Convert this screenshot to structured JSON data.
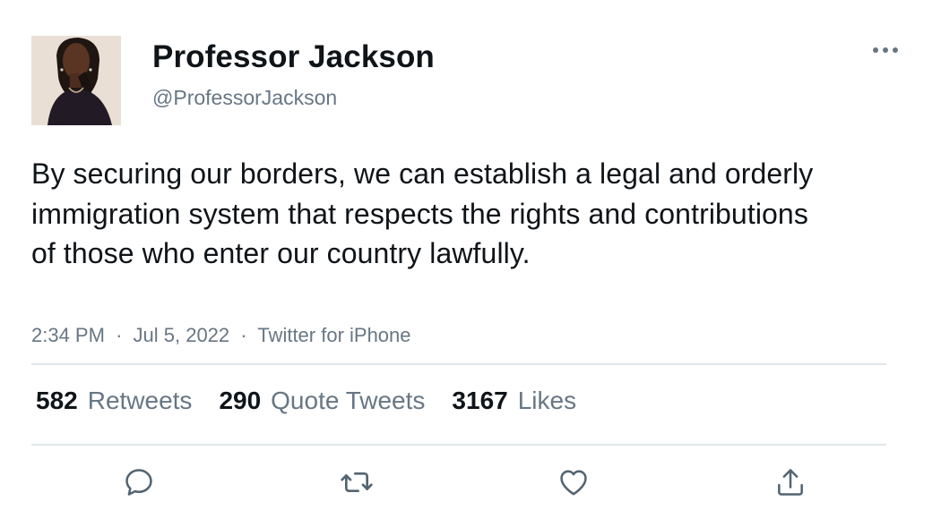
{
  "author": {
    "display_name": "Professor Jackson",
    "handle": "@ProfessorJackson",
    "avatar_icon": "profile-photo"
  },
  "more_icon": "more-horizontal-icon",
  "tweet": {
    "text": "By securing our borders, we can establish a legal and orderly immigration system that respects the rights and contributions of those who enter our country lawfully.",
    "time": "2:34 PM",
    "separator": "·",
    "date": "Jul 5, 2022",
    "source": "Twitter for iPhone"
  },
  "stats": {
    "retweets_count": "582",
    "retweets_label": "Retweets",
    "quotes_count": "290",
    "quotes_label": "Quote Tweets",
    "likes_count": "3167",
    "likes_label": "Likes"
  },
  "actions": [
    "reply-icon",
    "retweet-icon",
    "like-icon",
    "share-icon"
  ],
  "colors": {
    "text": "#0f1419",
    "secondary": "#687684",
    "divider": "#e1e6ea",
    "icon": "#536471"
  }
}
